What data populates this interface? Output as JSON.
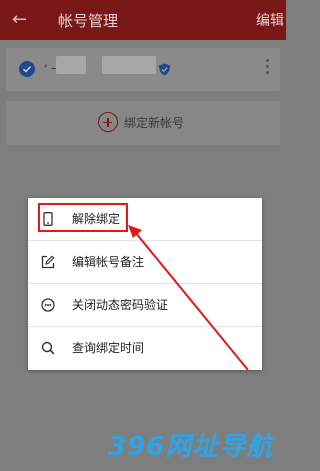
{
  "header": {
    "back_icon": "←",
    "title": "帐号管理",
    "edit_label": "编辑"
  },
  "account": {
    "name": ", _"
  },
  "bind_new": {
    "label": "绑定新帐号"
  },
  "menu": {
    "items": [
      {
        "label": "解除绑定",
        "icon": "phone-icon"
      },
      {
        "label": "编辑帐号备注",
        "icon": "edit-icon"
      },
      {
        "label": "关闭动态密码验证",
        "icon": "password-dots-icon"
      },
      {
        "label": "查询绑定时间",
        "icon": "search-icon"
      }
    ]
  },
  "watermark": {
    "text": "396网址导航"
  },
  "colors": {
    "header_bg": "#7a1717",
    "highlight": "#e0191a",
    "watermark": "#2fa3e6",
    "overlay": "#7e7e7e"
  }
}
